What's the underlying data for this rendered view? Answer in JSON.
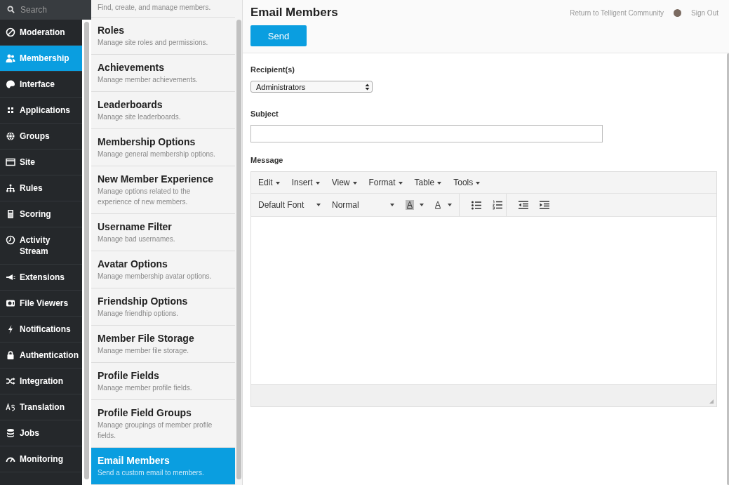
{
  "nav": {
    "search": {
      "placeholder": "Search"
    },
    "items": [
      {
        "label": "Moderation",
        "selected": false
      },
      {
        "label": "Membership",
        "selected": true
      },
      {
        "label": "Interface",
        "selected": false
      },
      {
        "label": "Applications",
        "selected": false
      },
      {
        "label": "Groups",
        "selected": false
      },
      {
        "label": "Site",
        "selected": false
      },
      {
        "label": "Rules",
        "selected": false
      },
      {
        "label": "Scoring",
        "selected": false
      },
      {
        "label": "Activity Stream",
        "selected": false
      },
      {
        "label": "Extensions",
        "selected": false
      },
      {
        "label": "File Viewers",
        "selected": false
      },
      {
        "label": "Notifications",
        "selected": false
      },
      {
        "label": "Authentication",
        "selected": false
      },
      {
        "label": "Integration",
        "selected": false
      },
      {
        "label": "Translation",
        "selected": false
      },
      {
        "label": "Jobs",
        "selected": false
      },
      {
        "label": "Monitoring",
        "selected": false
      }
    ]
  },
  "subnav": {
    "items": [
      {
        "description": "Find, create, and manage members.",
        "selected": false
      },
      {
        "title": "Roles",
        "description": "Manage site roles and permissions.",
        "selected": false
      },
      {
        "title": "Achievements",
        "description": "Manage member achievements.",
        "selected": false
      },
      {
        "title": "Leaderboards",
        "description": "Manage site leaderboards.",
        "selected": false
      },
      {
        "title": "Membership Options",
        "description": "Manage general membership options.",
        "selected": false
      },
      {
        "title": "New Member Experience",
        "description": "Manage options related to the experience of new members.",
        "selected": false
      },
      {
        "title": "Username Filter",
        "description": "Manage bad usernames.",
        "selected": false
      },
      {
        "title": "Avatar Options",
        "description": "Manage membership avatar options.",
        "selected": false
      },
      {
        "title": "Friendship Options",
        "description": "Manage friendhip options.",
        "selected": false
      },
      {
        "title": "Member File Storage",
        "description": "Manage member file storage.",
        "selected": false
      },
      {
        "title": "Profile Fields",
        "description": "Manage member profile fields.",
        "selected": false
      },
      {
        "title": "Profile Field Groups",
        "description": "Manage groupings of member profile fields.",
        "selected": false
      },
      {
        "title": "Email Members",
        "description": "Send a custom email to members.",
        "selected": true
      }
    ]
  },
  "header": {
    "title": "Email Members",
    "return_link": "Return to Telligent Community",
    "sign_out": "Sign Out",
    "send_button": "Send"
  },
  "form": {
    "recipients": {
      "label": "Recipient(s)",
      "value": "Administrators"
    },
    "subject": {
      "label": "Subject"
    },
    "message": {
      "label": "Message",
      "menu": [
        "Edit",
        "Insert",
        "View",
        "Format",
        "Table",
        "Tools"
      ],
      "toolbar": [
        {
          "kind": "dropdown",
          "label": "Default Font"
        },
        {
          "kind": "dropdown",
          "label": "Normal"
        },
        {
          "kind": "highlight",
          "label": "A"
        },
        {
          "kind": "text-color",
          "label": "A"
        },
        {
          "kind": "separator"
        },
        {
          "kind": "bullet-list"
        },
        {
          "kind": "numbered-list"
        },
        {
          "kind": "separator"
        },
        {
          "kind": "outdent"
        },
        {
          "kind": "indent"
        }
      ]
    }
  }
}
